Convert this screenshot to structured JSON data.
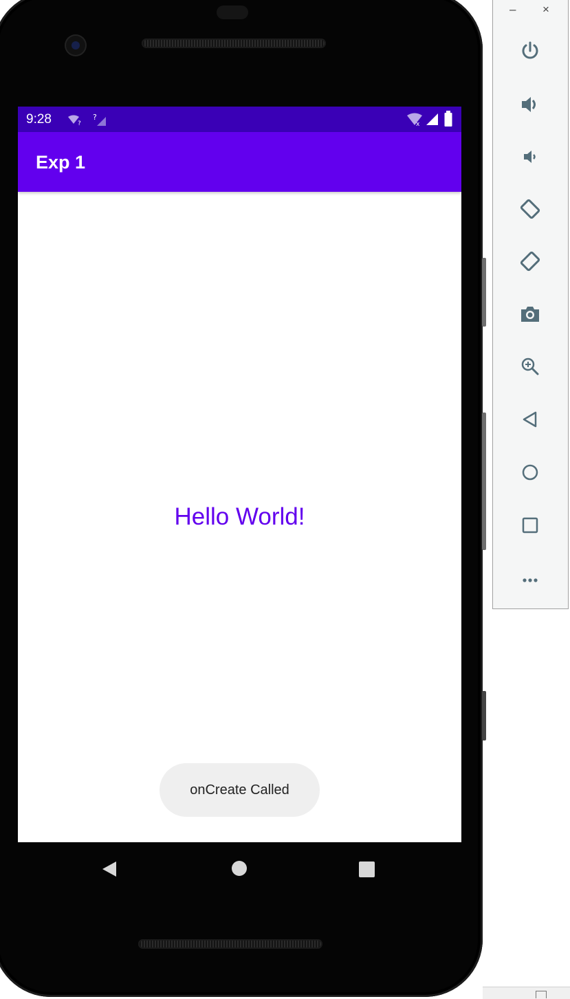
{
  "status_bar": {
    "time": "9:28",
    "left_icons": [
      "wifi-question-icon",
      "signal-question-icon"
    ],
    "right_icons": [
      "wifi-x-icon",
      "cell-signal-icon",
      "battery-icon"
    ],
    "background": "#3a00b6"
  },
  "app_bar": {
    "title": "Exp 1",
    "background": "#6200ee"
  },
  "content": {
    "message": "Hello World!",
    "message_color": "#6200ee"
  },
  "toast": {
    "text": "onCreate Called"
  },
  "nav_bar": {
    "buttons": [
      "back-icon",
      "home-icon",
      "recents-icon"
    ]
  },
  "emulator_toolbar": {
    "window_controls": {
      "minimize": "–",
      "close": "×"
    },
    "buttons": [
      "power-icon",
      "volume-up-icon",
      "volume-down-icon",
      "rotate-left-icon",
      "rotate-right-icon",
      "camera-icon",
      "zoom-icon",
      "back-icon",
      "home-icon",
      "overview-icon",
      "more-icon"
    ]
  }
}
